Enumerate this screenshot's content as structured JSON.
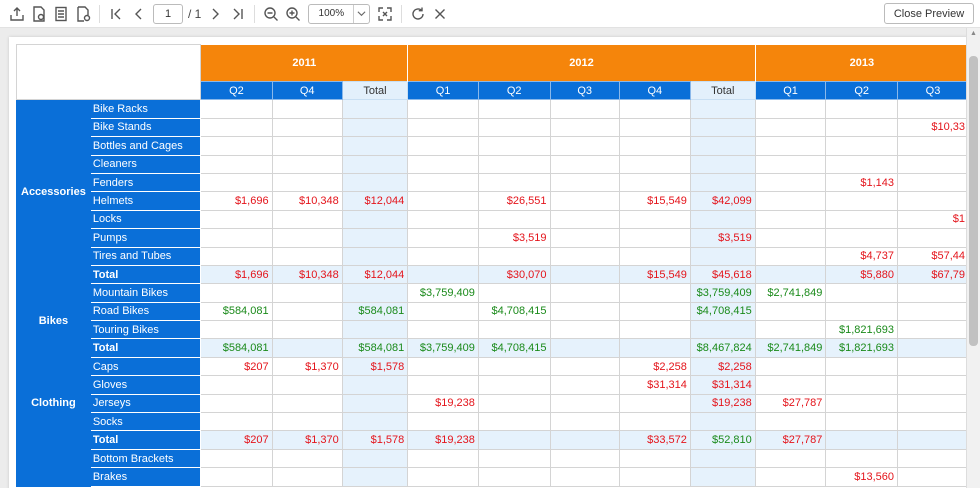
{
  "toolbar": {
    "page_current": "1",
    "page_total": "/ 1",
    "zoom": "100%",
    "close_label": "Close Preview"
  },
  "pivot": {
    "years": [
      {
        "label": "2011",
        "span": 3
      },
      {
        "label": "2012",
        "span": 5
      },
      {
        "label": "2013",
        "span": 3
      }
    ],
    "quarters": [
      "Q2",
      "Q4",
      "Total",
      "Q1",
      "Q2",
      "Q3",
      "Q4",
      "Total",
      "Q1",
      "Q2",
      "Q3"
    ],
    "total_cols": [
      2,
      7
    ],
    "groups": [
      {
        "name": "Accessories",
        "rows": [
          {
            "label": "Bike Racks",
            "cells": [
              "",
              "",
              "",
              "",
              "",
              "",
              "",
              "",
              "",
              "",
              ""
            ]
          },
          {
            "label": "Bike Stands",
            "cells": [
              "",
              "",
              "",
              "",
              "",
              "",
              "",
              "",
              "",
              "",
              "$10,33"
            ]
          },
          {
            "label": "Bottles and Cages",
            "cells": [
              "",
              "",
              "",
              "",
              "",
              "",
              "",
              "",
              "",
              "",
              ""
            ]
          },
          {
            "label": "Cleaners",
            "cells": [
              "",
              "",
              "",
              "",
              "",
              "",
              "",
              "",
              "",
              "",
              ""
            ]
          },
          {
            "label": "Fenders",
            "cells": [
              "",
              "",
              "",
              "",
              "",
              "",
              "",
              "",
              "",
              "$1,143",
              ""
            ]
          },
          {
            "label": "Helmets",
            "cells": [
              "$1,696",
              "$10,348",
              "$12,044",
              "",
              "$26,551",
              "",
              "$15,549",
              "$42,099",
              "",
              "",
              ""
            ]
          },
          {
            "label": "Locks",
            "cells": [
              "",
              "",
              "",
              "",
              "",
              "",
              "",
              "",
              "",
              "",
              "$1"
            ]
          },
          {
            "label": "Pumps",
            "cells": [
              "",
              "",
              "",
              "",
              "$3,519",
              "",
              "",
              "$3,519",
              "",
              "",
              ""
            ]
          },
          {
            "label": "Tires and Tubes",
            "cells": [
              "",
              "",
              "",
              "",
              "",
              "",
              "",
              "",
              "",
              "$4,737",
              "$57,44"
            ]
          },
          {
            "label": "Total",
            "total": true,
            "cells": [
              "$1,696",
              "$10,348",
              "$12,044",
              "",
              "$30,070",
              "",
              "$15,549",
              "$45,618",
              "",
              "$5,880",
              "$67,79"
            ]
          }
        ]
      },
      {
        "name": "Bikes",
        "rows": [
          {
            "label": "Mountain Bikes",
            "cells": [
              "",
              "",
              "",
              "$3,759,409",
              "",
              "",
              "",
              "$3,759,409",
              "$2,741,849",
              "",
              ""
            ]
          },
          {
            "label": "Road Bikes",
            "cells": [
              "$584,081",
              "",
              "$584,081",
              "",
              "$4,708,415",
              "",
              "",
              "$4,708,415",
              "",
              "",
              ""
            ]
          },
          {
            "label": "Touring Bikes",
            "cells": [
              "",
              "",
              "",
              "",
              "",
              "",
              "",
              "",
              "",
              "$1,821,693",
              ""
            ]
          },
          {
            "label": "Total",
            "total": true,
            "cells": [
              "$584,081",
              "",
              "$584,081",
              "$3,759,409",
              "$4,708,415",
              "",
              "",
              "$8,467,824",
              "$2,741,849",
              "$1,821,693",
              ""
            ]
          }
        ]
      },
      {
        "name": "Clothing",
        "rows": [
          {
            "label": "Caps",
            "cells": [
              "$207",
              "$1,370",
              "$1,578",
              "",
              "",
              "",
              "$2,258",
              "$2,258",
              "",
              "",
              ""
            ]
          },
          {
            "label": "Gloves",
            "cells": [
              "",
              "",
              "",
              "",
              "",
              "",
              "$31,314",
              "$31,314",
              "",
              "",
              ""
            ]
          },
          {
            "label": "Jerseys",
            "cells": [
              "",
              "",
              "",
              "$19,238",
              "",
              "",
              "",
              "$19,238",
              "$27,787",
              "",
              ""
            ]
          },
          {
            "label": "Socks",
            "cells": [
              "",
              "",
              "",
              "",
              "",
              "",
              "",
              "",
              "",
              "",
              ""
            ]
          },
          {
            "label": "Total",
            "total": true,
            "cells": [
              "$207",
              "$1,370",
              "$1,578",
              "$19,238",
              "",
              "",
              "$33,572",
              "$52,810",
              "$27,787",
              "",
              ""
            ]
          }
        ]
      },
      {
        "name": "",
        "rows": [
          {
            "label": "Bottom Brackets",
            "cells": [
              "",
              "",
              "",
              "",
              "",
              "",
              "",
              "",
              "",
              "",
              ""
            ]
          },
          {
            "label": "Brakes",
            "cells": [
              "",
              "",
              "",
              "",
              "",
              "",
              "",
              "",
              "",
              "$13,560",
              ""
            ]
          }
        ]
      }
    ],
    "colors": {
      "header_orange": "#f5850b",
      "header_blue": "#0a6fd8",
      "loss": "#e4141b",
      "gain": "#1a8a1a",
      "total_fill": "#e6f2fc"
    }
  }
}
